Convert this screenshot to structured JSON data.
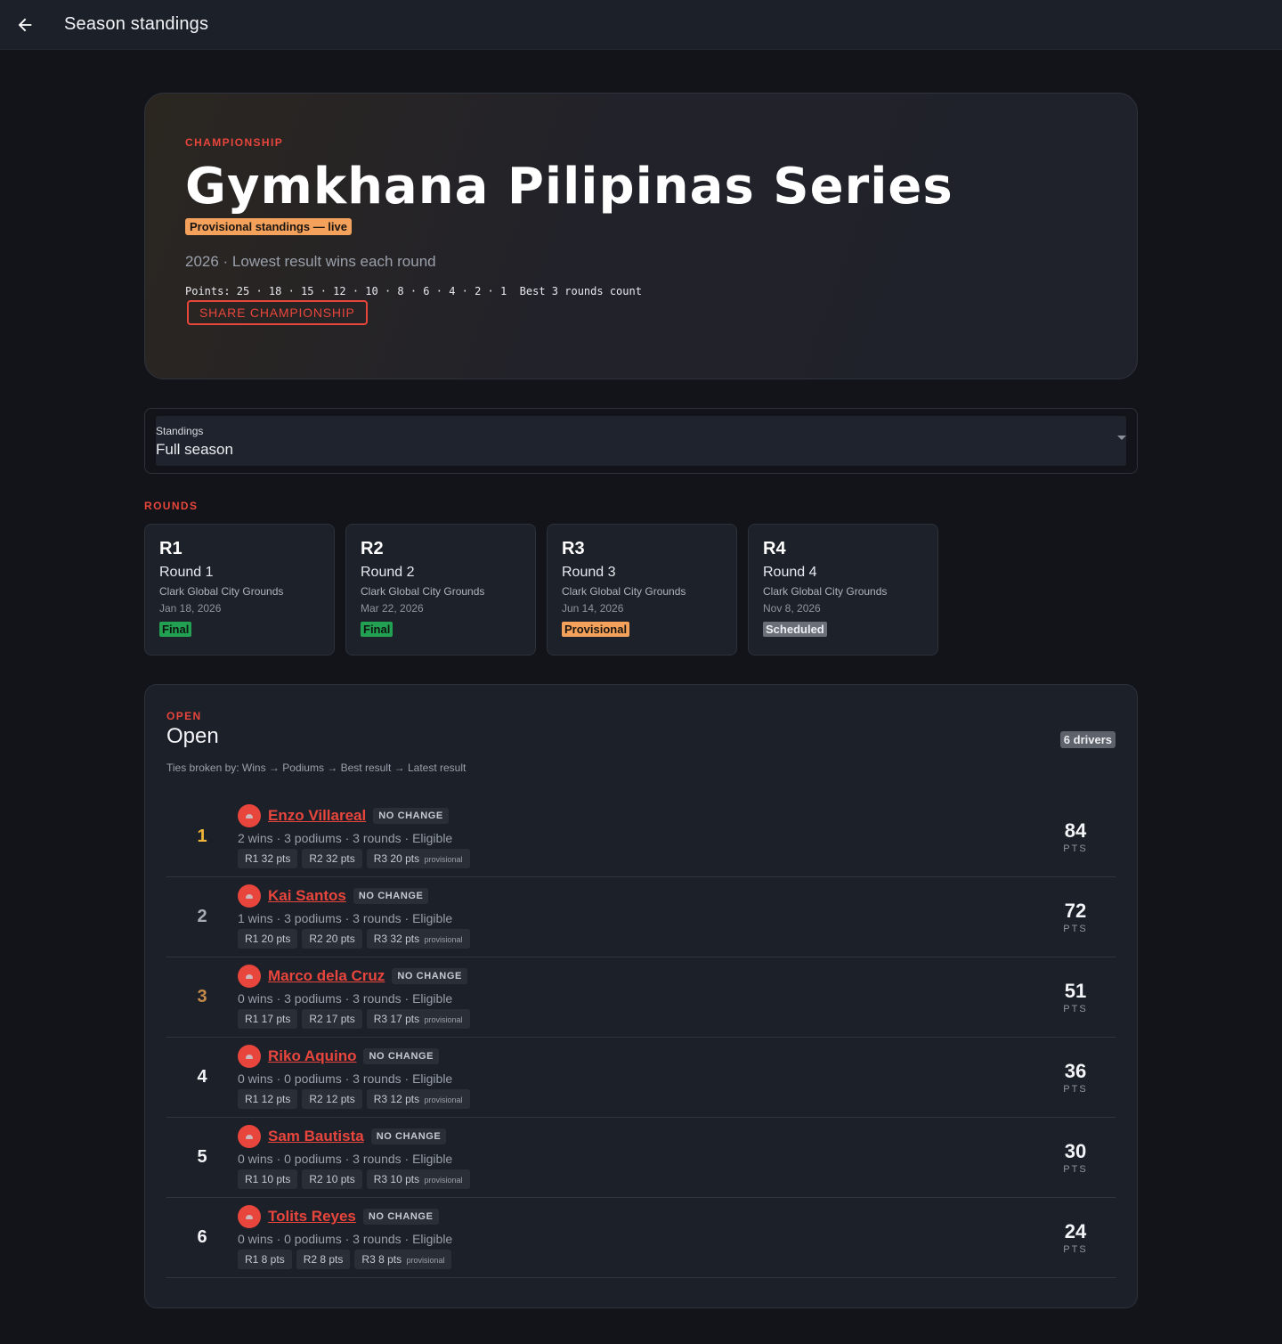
{
  "topbar": {
    "title": "Season standings"
  },
  "hero": {
    "eyebrow": "CHAMPIONSHIP",
    "title": "Gymkhana Pilipinas Series",
    "status": "Provisional standings — live",
    "subtitle": "2026 · Lowest result wins each round",
    "points_line": "Points: 25 · 18 · 15 · 12 · 10 · 8 · 6 · 4 · 2 · 1  Best 3 rounds count",
    "share_label": "SHARE CHAMPIONSHIP"
  },
  "standings_select": {
    "label": "Standings",
    "value": "Full season"
  },
  "rounds_label": "ROUNDS",
  "rounds": [
    {
      "code": "R1",
      "name": "Round 1",
      "venue": "Clark Global City Grounds",
      "date": "Jan 18, 2026",
      "status": "Final",
      "status_color": "#23a153"
    },
    {
      "code": "R2",
      "name": "Round 2",
      "venue": "Clark Global City Grounds",
      "date": "Mar 22, 2026",
      "status": "Final",
      "status_color": "#23a153"
    },
    {
      "code": "R3",
      "name": "Round 3",
      "venue": "Clark Global City Grounds",
      "date": "Jun 14, 2026",
      "status": "Provisional",
      "status_color": "#f4a25b"
    },
    {
      "code": "R4",
      "name": "Round 4",
      "venue": "Clark Global City Grounds",
      "date": "Nov 8, 2026",
      "status": "Scheduled",
      "status_color": "#6b6f78"
    }
  ],
  "class_block": {
    "eyebrow": "OPEN",
    "title": "Open",
    "driver_count": "6 drivers",
    "tiebreak": "Ties broken by: Wins → Podiums → Best result → Latest result",
    "pts_unit": "PTS",
    "standings": [
      {
        "pos": "1",
        "name": "Enzo Villareal",
        "change": "NO CHANGE",
        "meta": "2 wins · 3 podiums · 3 rounds · Eligible",
        "r1": "R1 32 pts",
        "r2": "R2 32 pts",
        "r3": "R3 20 pts",
        "r3_tag": "provisional",
        "points": "84"
      },
      {
        "pos": "2",
        "name": "Kai Santos",
        "change": "NO CHANGE",
        "meta": "1 wins · 3 podiums · 3 rounds · Eligible",
        "r1": "R1 20 pts",
        "r2": "R2 20 pts",
        "r3": "R3 32 pts",
        "r3_tag": "provisional",
        "points": "72"
      },
      {
        "pos": "3",
        "name": "Marco dela Cruz",
        "change": "NO CHANGE",
        "meta": "0 wins · 3 podiums · 3 rounds · Eligible",
        "r1": "R1 17 pts",
        "r2": "R2 17 pts",
        "r3": "R3 17 pts",
        "r3_tag": "provisional",
        "points": "51"
      },
      {
        "pos": "4",
        "name": "Riko Aquino",
        "change": "NO CHANGE",
        "meta": "0 wins · 0 podiums · 3 rounds · Eligible",
        "r1": "R1 12 pts",
        "r2": "R2 12 pts",
        "r3": "R3 12 pts",
        "r3_tag": "provisional",
        "points": "36"
      },
      {
        "pos": "5",
        "name": "Sam Bautista",
        "change": "NO CHANGE",
        "meta": "0 wins · 0 podiums · 3 rounds · Eligible",
        "r1": "R1 10 pts",
        "r2": "R2 10 pts",
        "r3": "R3 10 pts",
        "r3_tag": "provisional",
        "points": "30"
      },
      {
        "pos": "6",
        "name": "Tolits Reyes",
        "change": "NO CHANGE",
        "meta": "0 wins · 0 podiums · 3 rounds · Eligible",
        "r1": "R1 8 pts",
        "r2": "R2 8 pts",
        "r3": "R3 8 pts",
        "r3_tag": "provisional",
        "points": "24"
      }
    ]
  },
  "colors": {
    "accent": "#e8453c",
    "gold": "#f0b536",
    "silver": "#a7adb7",
    "bronze": "#c48a4a"
  }
}
